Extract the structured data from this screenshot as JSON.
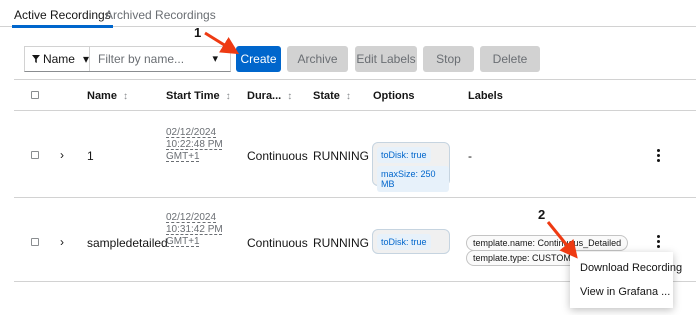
{
  "tabs": {
    "active": "Active Recordings",
    "archived": "Archived Recordings"
  },
  "toolbar": {
    "filter_attribute": "Name",
    "filter_placeholder": "Filter by name...",
    "create": "Create",
    "archive": "Archive",
    "edit_labels": "Edit Labels",
    "stop": "Stop",
    "delete": "Delete"
  },
  "table": {
    "headers": {
      "name": "Name",
      "start_time": "Start Time",
      "duration": "Dura...",
      "state": "State",
      "options": "Options",
      "labels": "Labels"
    },
    "rows": [
      {
        "name": "1",
        "start_time": [
          "02/12/2024",
          "10:22:48 PM",
          "GMT+1"
        ],
        "duration": "Continuous",
        "state": "RUNNING",
        "options": [
          "toDisk: true",
          "maxSize: 250 MB"
        ],
        "labels": "-"
      },
      {
        "name": "sampledetailed",
        "start_time": [
          "02/12/2024",
          "10:31:42 PM",
          "GMT+1"
        ],
        "duration": "Continuous",
        "state": "RUNNING",
        "options": [
          "toDisk: true"
        ],
        "labels": [
          "template.name: Continuous_Detailed",
          "template.type: CUSTOM"
        ]
      }
    ]
  },
  "menu": {
    "items": [
      "Download Recording",
      "View in Grafana ..."
    ]
  },
  "annotations": {
    "one": "1",
    "two": "2"
  },
  "colors": {
    "primary": "#0066cc",
    "arrow": "#ee3a12",
    "disabled": "#d2d2d2"
  }
}
